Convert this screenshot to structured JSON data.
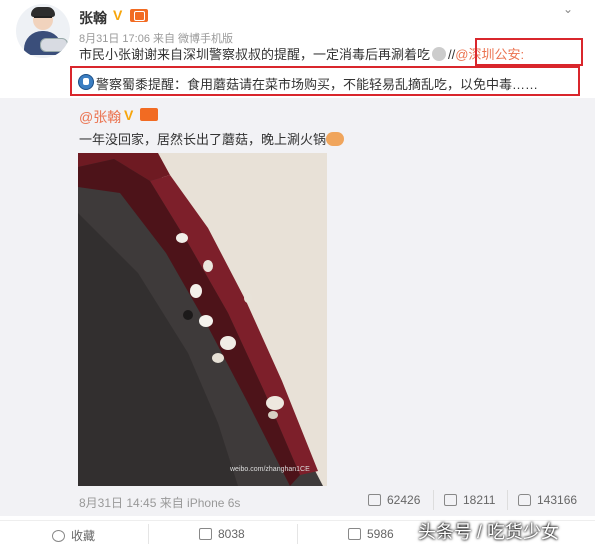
{
  "header": {
    "name": "张翰",
    "meta": "8月31日 17:06 来自 微博手机版",
    "more_icon": "chevron-down-icon"
  },
  "post": {
    "text_before": "市民小张谢谢来自深圳警察叔叔的提醒，一定消毒后再涮着吃",
    "text_sep": "//",
    "mention": "@深圳公安:",
    "quote": "警察蜀黍提醒：食用蘑菇请在菜市场购买，不能轻易乱摘乱吃，以免中毒……"
  },
  "repost": {
    "author": "@张翰",
    "text": "一年没回家，居然长出了蘑菇，晚上涮火锅",
    "photo_watermark": "weibo.com/zhanghan1CE",
    "time": "8月31日 14:45 来自 iPhone 6s",
    "share_count": "62426",
    "comment_count": "18211",
    "like_count": "143166"
  },
  "footer": {
    "collect_label": "收藏",
    "forward_count": "8038",
    "comment_count": "5986"
  },
  "watermark": "头条号 / 吃货少女",
  "colors": {
    "mention": "#eb7350",
    "highlight_box": "#d9262c",
    "repost_bg": "#f2f2f5",
    "verified": "#f7a50b"
  }
}
